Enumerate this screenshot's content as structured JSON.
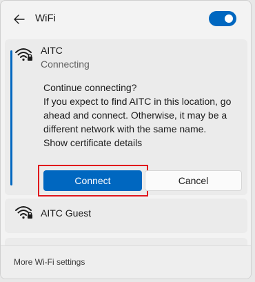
{
  "header": {
    "title": "WiFi",
    "back_icon": "back-arrow-icon",
    "toggle_on": true,
    "accent_color": "#0067c0"
  },
  "networks": {
    "active": {
      "name": "AITC",
      "status": "Connecting",
      "message_lines": [
        "Continue connecting?",
        "If you expect to find AITC in this location, go",
        "ahead and connect. Otherwise, it may be a",
        "different network with the same name.",
        "Show certificate details"
      ],
      "connect_label": "Connect",
      "cancel_label": "Cancel",
      "highlight_color": "#e0151c"
    },
    "guest": {
      "name": "AITC Guest"
    }
  },
  "footer": {
    "link": "More Wi-Fi settings"
  }
}
